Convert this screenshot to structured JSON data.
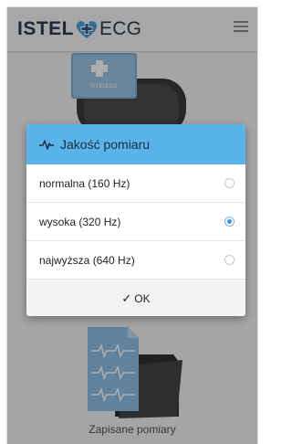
{
  "header": {
    "logo_left": "ISTEL",
    "logo_right": "ECG",
    "menu_icon": "hamburger-menu-icon"
  },
  "tiles": {
    "top_icon": "ecg-device-icon",
    "top_device_text": "ISTELECG",
    "bottom_icon": "saved-documents-folder-icon",
    "bottom_caption": "Zapisane pomiary"
  },
  "dialog": {
    "icon": "pulse-icon",
    "title": "Jakość pomiaru",
    "options": [
      {
        "label": "normalna (160 Hz)",
        "selected": false
      },
      {
        "label": "wysoka (320 Hz)",
        "selected": true
      },
      {
        "label": "najwyższa (640 Hz)",
        "selected": false
      }
    ],
    "ok_icon": "check-icon",
    "ok_check": "✓",
    "ok_label": "OK"
  },
  "colors": {
    "header_blue": "#5ab4ea",
    "logo_navy": "#2b3a55",
    "radio_selected": "#3d95de"
  }
}
